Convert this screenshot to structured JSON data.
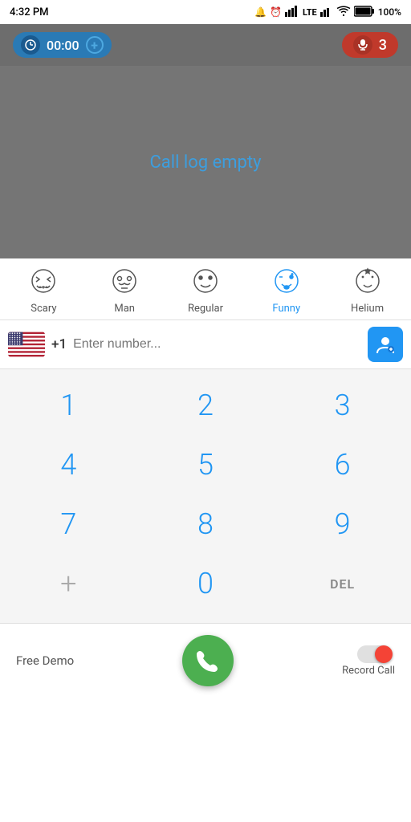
{
  "statusBar": {
    "time": "4:32 PM",
    "battery": "100%"
  },
  "callHeader": {
    "timerValue": "00:00",
    "micCount": "3"
  },
  "callLog": {
    "emptyMessage": "Call log empty"
  },
  "voiceFilters": [
    {
      "id": "scary",
      "label": "Scary",
      "active": false
    },
    {
      "id": "man",
      "label": "Man",
      "active": false
    },
    {
      "id": "regular",
      "label": "Regular",
      "active": false
    },
    {
      "id": "funny",
      "label": "Funny",
      "active": true
    },
    {
      "id": "helium",
      "label": "Helium",
      "active": false
    }
  ],
  "phoneInput": {
    "countryCode": "+1",
    "placeholder": "Enter number..."
  },
  "dialPad": {
    "rows": [
      [
        "1",
        "2",
        "3"
      ],
      [
        "4",
        "5",
        "6"
      ],
      [
        "7",
        "8",
        "9"
      ],
      [
        "+",
        "0",
        "DEL"
      ]
    ]
  },
  "bottomBar": {
    "freeDemoLabel": "Free Demo",
    "recordCallLabel": "Record Call"
  }
}
